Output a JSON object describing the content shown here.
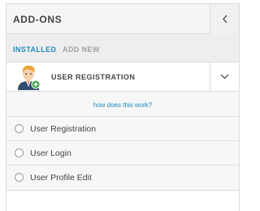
{
  "header": {
    "title": "ADD-ONS",
    "back_icon": "chevron-left-icon"
  },
  "tabs": [
    {
      "label": "INSTALLED",
      "active": true
    },
    {
      "label": "ADD NEW",
      "active": false
    }
  ],
  "addon": {
    "name": "USER REGISTRATION",
    "avatar_icon": "user-add-avatar-icon",
    "toggle_icon": "chevron-down-icon"
  },
  "details": {
    "help_link": "how does this work?",
    "options": [
      {
        "label": "User Registration",
        "selected": false
      },
      {
        "label": "User Login",
        "selected": false
      },
      {
        "label": "User Profile Edit",
        "selected": false
      }
    ]
  },
  "colors": {
    "accent": "#1e8cbe",
    "header_bg": "#f5f5f5",
    "tab_bg": "#eeeeee",
    "badge_green": "#3aa64b"
  }
}
